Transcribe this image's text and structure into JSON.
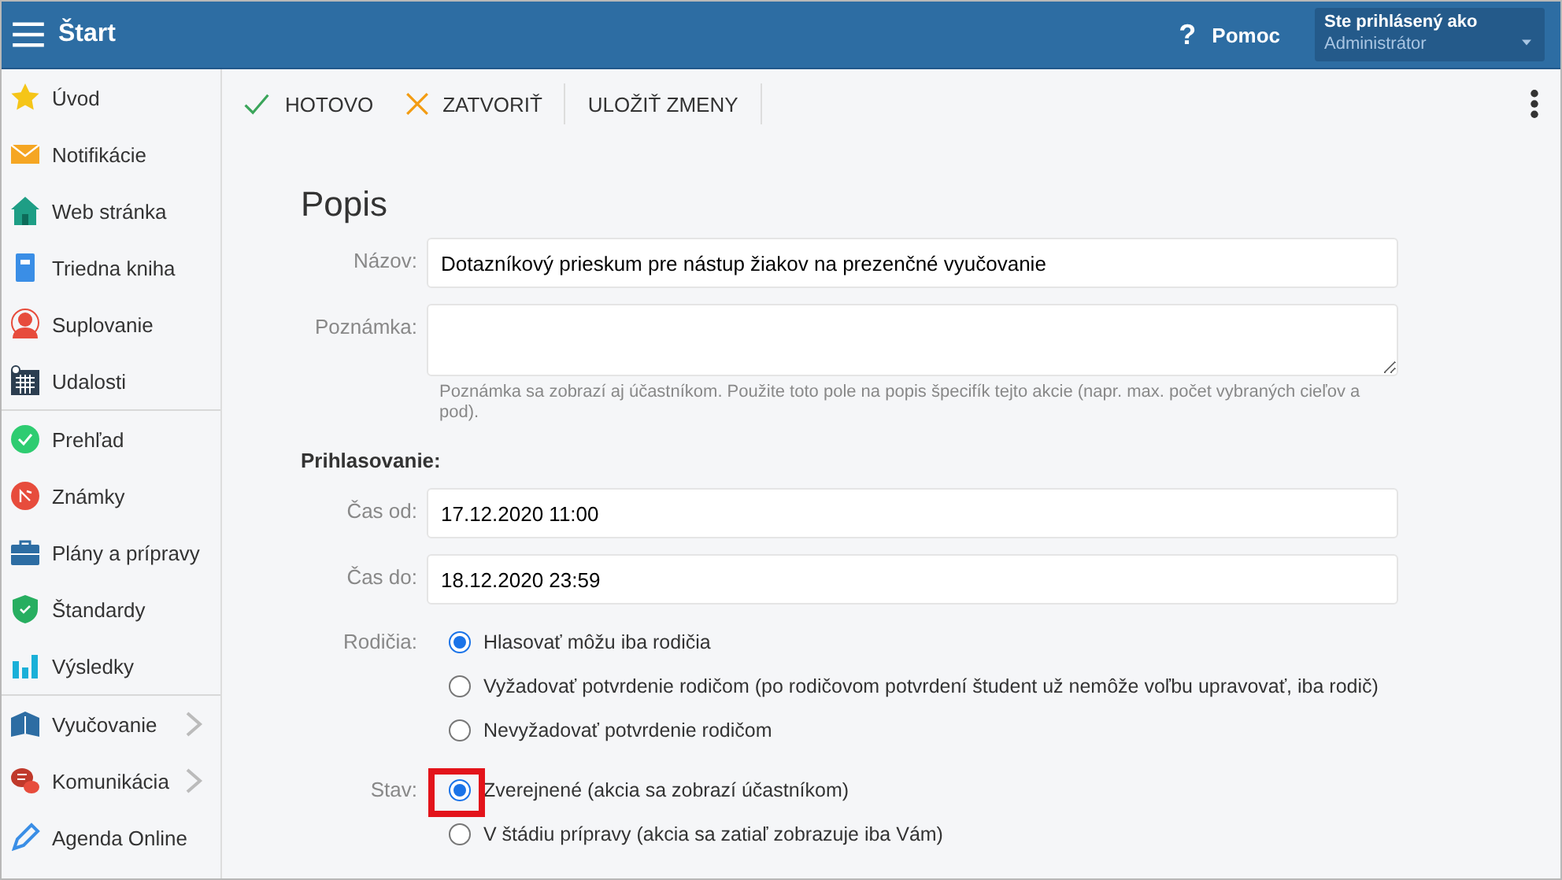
{
  "header": {
    "title": "Štart",
    "help": {
      "icon": "?",
      "label": "Pomoc"
    },
    "user": {
      "caption": "Ste prihlásený ako",
      "role": "Administrátor"
    }
  },
  "sidebar": {
    "sections": [
      {
        "items": [
          {
            "label": "Úvod",
            "expandable": false
          },
          {
            "label": "Notifikácie",
            "expandable": false
          },
          {
            "label": "Web stránka",
            "expandable": false
          },
          {
            "label": "Triedna kniha",
            "expandable": false
          },
          {
            "label": "Suplovanie",
            "expandable": false
          },
          {
            "label": "Udalosti",
            "expandable": false
          }
        ]
      },
      {
        "items": [
          {
            "label": "Prehľad",
            "expandable": false
          },
          {
            "label": "Známky",
            "expandable": false
          },
          {
            "label": "Plány a prípravy",
            "expandable": false
          },
          {
            "label": "Štandardy",
            "expandable": false
          },
          {
            "label": "Výsledky",
            "expandable": false
          }
        ]
      },
      {
        "items": [
          {
            "label": "Vyučovanie",
            "expandable": true
          },
          {
            "label": "Komunikácia",
            "expandable": true
          },
          {
            "label": "Agenda Online",
            "expandable": false
          }
        ]
      }
    ]
  },
  "toolbar": {
    "buttons": [
      {
        "kind": "confirm",
        "label": "HOTOVO"
      },
      {
        "kind": "cancel",
        "label": "ZATVORIŤ"
      },
      {
        "kind": "plain",
        "label": "ULOŽIŤ ZMENY"
      }
    ]
  },
  "form": {
    "title": "Popis",
    "name": {
      "label": "Názov:",
      "value": "Dotazníkový prieskum pre nástup žiakov na prezenčné vyučovanie"
    },
    "note": {
      "label": "Poznámka:",
      "hint": "Poznámka sa zobrazí aj účastníkom. Použite toto pole na popis špecifík tejto akcie (napr. max. počet vybraných cieľov a pod)."
    },
    "section": "Prihlasovanie:",
    "time_from": {
      "label": "Čas od:",
      "value": "17.12.2020 11:00"
    },
    "time_to": {
      "label": "Čas do:",
      "value": "18.12.2020 23:59"
    },
    "radio_groups": [
      {
        "label": "Rodičia:",
        "options": [
          {
            "label": "Hlasovať môžu iba rodičia",
            "selected": true,
            "highlighted": false
          },
          {
            "label": "Vyžadovať potvrdenie rodičom (po rodičovom potvrdení študent už nemôže voľbu upravovať, iba rodič)",
            "selected": false,
            "highlighted": false
          },
          {
            "label": "Nevyžadovať potvrdenie rodičom",
            "selected": false,
            "highlighted": false
          }
        ]
      },
      {
        "label": "Stav:",
        "options": [
          {
            "label": "Zverejnené (akcia sa zobrazí účastníkom)",
            "selected": true,
            "highlighted": true
          },
          {
            "label": "V štádiu prípravy (akcia sa zatiaľ zobrazuje iba Vám)",
            "selected": false,
            "highlighted": false
          }
        ]
      }
    ]
  }
}
